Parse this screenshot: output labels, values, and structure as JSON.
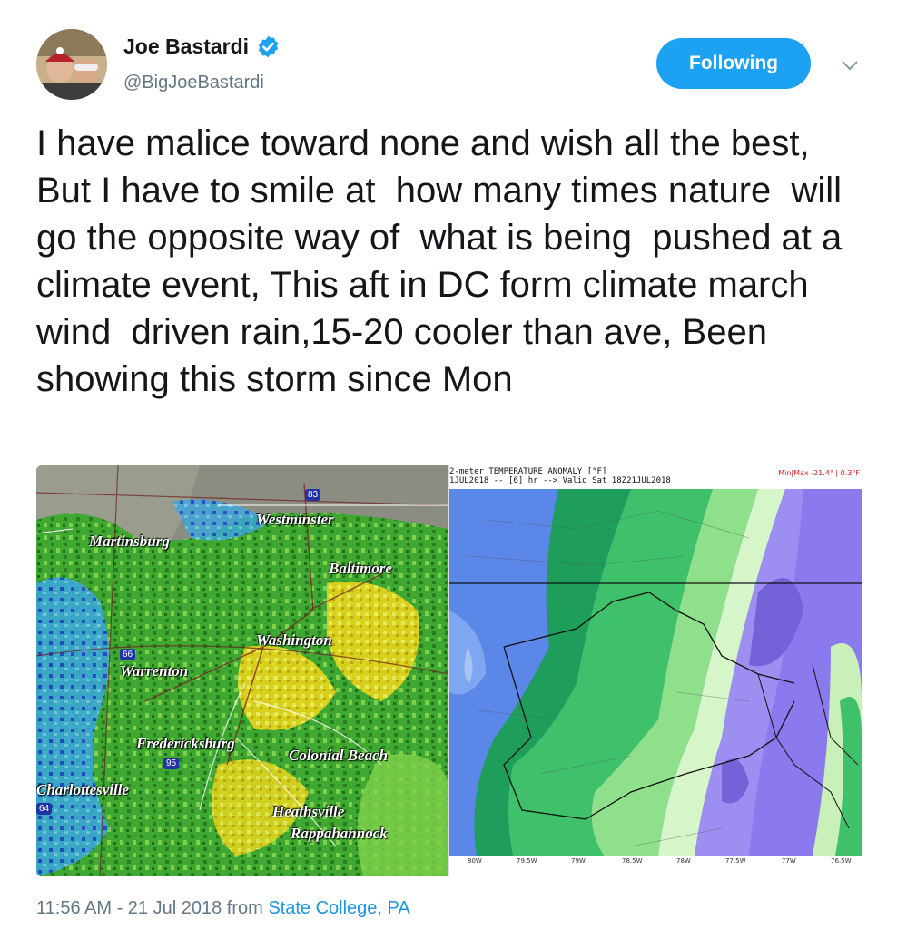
{
  "user": {
    "display_name": "Joe Bastardi",
    "handle": "@BigJoeBastardi"
  },
  "follow_button_label": "Following",
  "tweet_text": "I have malice toward none and wish all the best,  But I have to smile at  how many times nature  will go the opposite way of  what is being  pushed at a climate event, This aft in DC form climate march wind  driven rain,15-20 cooler than ave, Been showing this storm since Mon",
  "radar_map": {
    "labels": [
      "Westminster",
      "Martinsburg",
      "Baltimore",
      "Washington",
      "Warrenton",
      "Fredericksburg",
      "Colonial Beach",
      "Charlottesville",
      "Heathsville",
      "Rappahannock"
    ],
    "highway_shields": [
      "83",
      "66",
      "95",
      "64"
    ]
  },
  "anomaly_map": {
    "header_line1": "2-meter TEMPERATURE ANOMALY [°F]",
    "header_line2": "1JUL2018 -- [6] hr --> Valid Sat 18Z21JUL2018",
    "minmax": "Min|Max -21.4° | 0.3°F",
    "x_ticks": [
      "80W",
      "79.5W",
      "79W",
      "78.5W",
      "78W",
      "77.5W",
      "77W",
      "76.5W"
    ]
  },
  "timestamp": {
    "text": "11:56 AM - 21 Jul 2018 from ",
    "location": "State College, PA"
  },
  "colors": {
    "accent": "#1da1f2",
    "link": "#1b95e0",
    "secondary_text": "#657786"
  }
}
